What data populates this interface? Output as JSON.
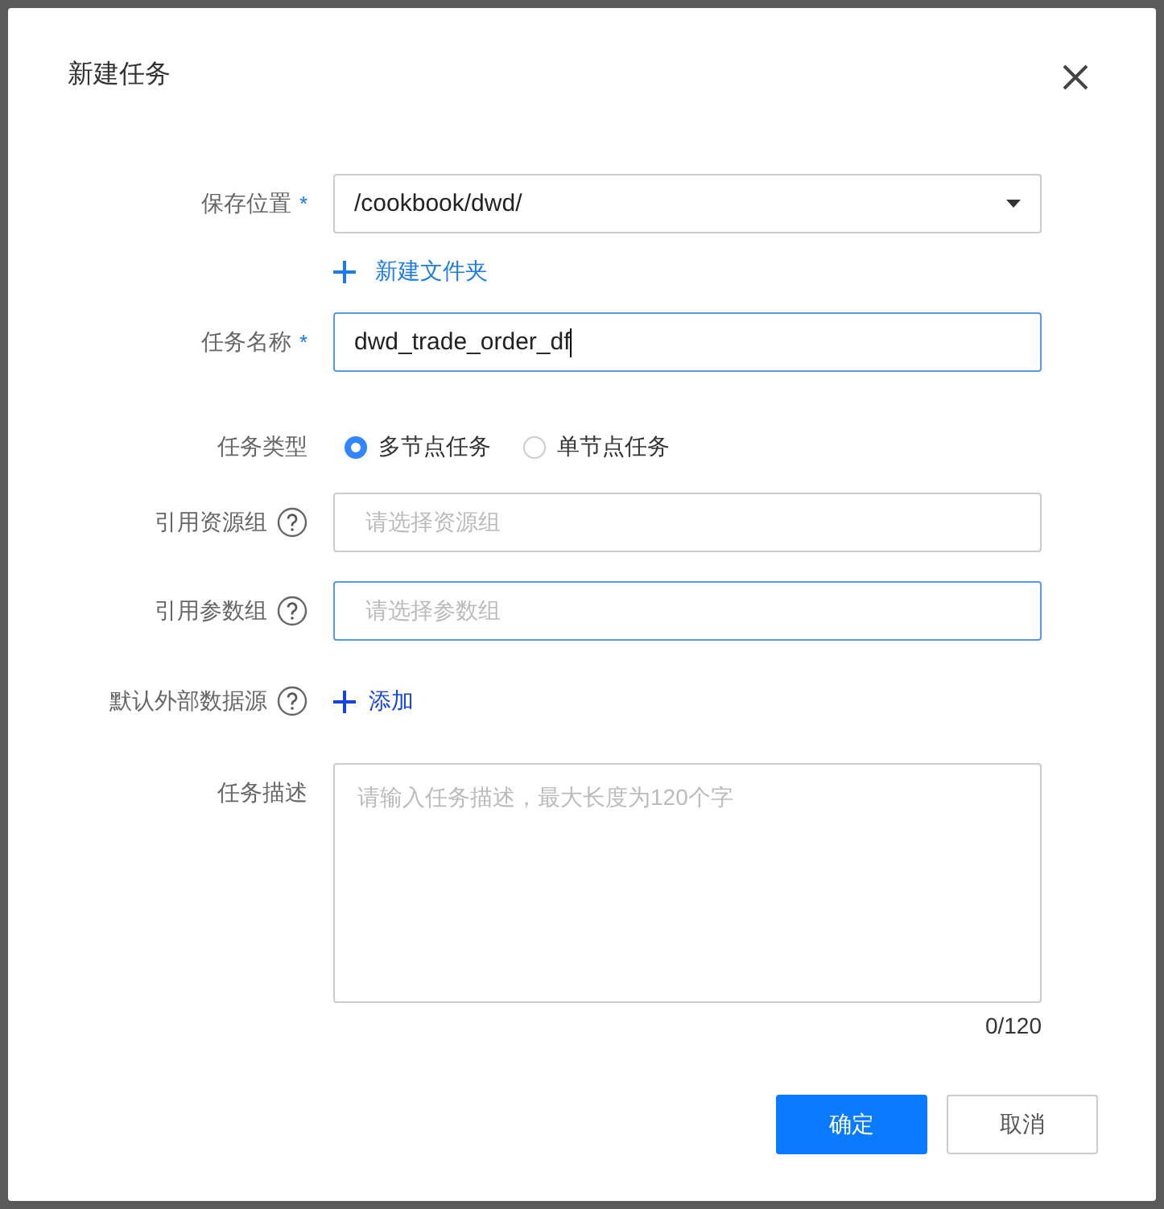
{
  "dialog": {
    "title": "新建任务"
  },
  "fields": [
    {
      "kind": "select",
      "label": "保存位置",
      "required_mark": "*",
      "help": false,
      "value": "/cookbook/dwd/",
      "focused": false,
      "link": "新建文件夹"
    },
    {
      "kind": "input",
      "label": "任务名称",
      "required_mark": "*",
      "help": false,
      "value": "dwd_trade_order_df",
      "focused": true
    },
    {
      "kind": "radio",
      "label": "任务类型",
      "help": false,
      "options": [
        {
          "label": "多节点任务",
          "selected": true
        },
        {
          "label": "单节点任务",
          "selected": false
        }
      ]
    },
    {
      "kind": "input",
      "label": "引用资源组",
      "help": true,
      "placeholder": "请选择资源组",
      "focused": false
    },
    {
      "kind": "input",
      "label": "引用参数组",
      "help": true,
      "placeholder": "请选择参数组",
      "focused": true
    },
    {
      "kind": "add",
      "label": "默认外部数据源",
      "help": true,
      "link": "添加"
    },
    {
      "kind": "textarea",
      "label": "任务描述",
      "help": false,
      "placeholder": "请输入任务描述，最大长度为120个字",
      "focused": false,
      "counter": "0/120"
    }
  ],
  "buttons": [
    {
      "label": "确定",
      "primary": true
    },
    {
      "label": "取消",
      "primary": false
    }
  ]
}
